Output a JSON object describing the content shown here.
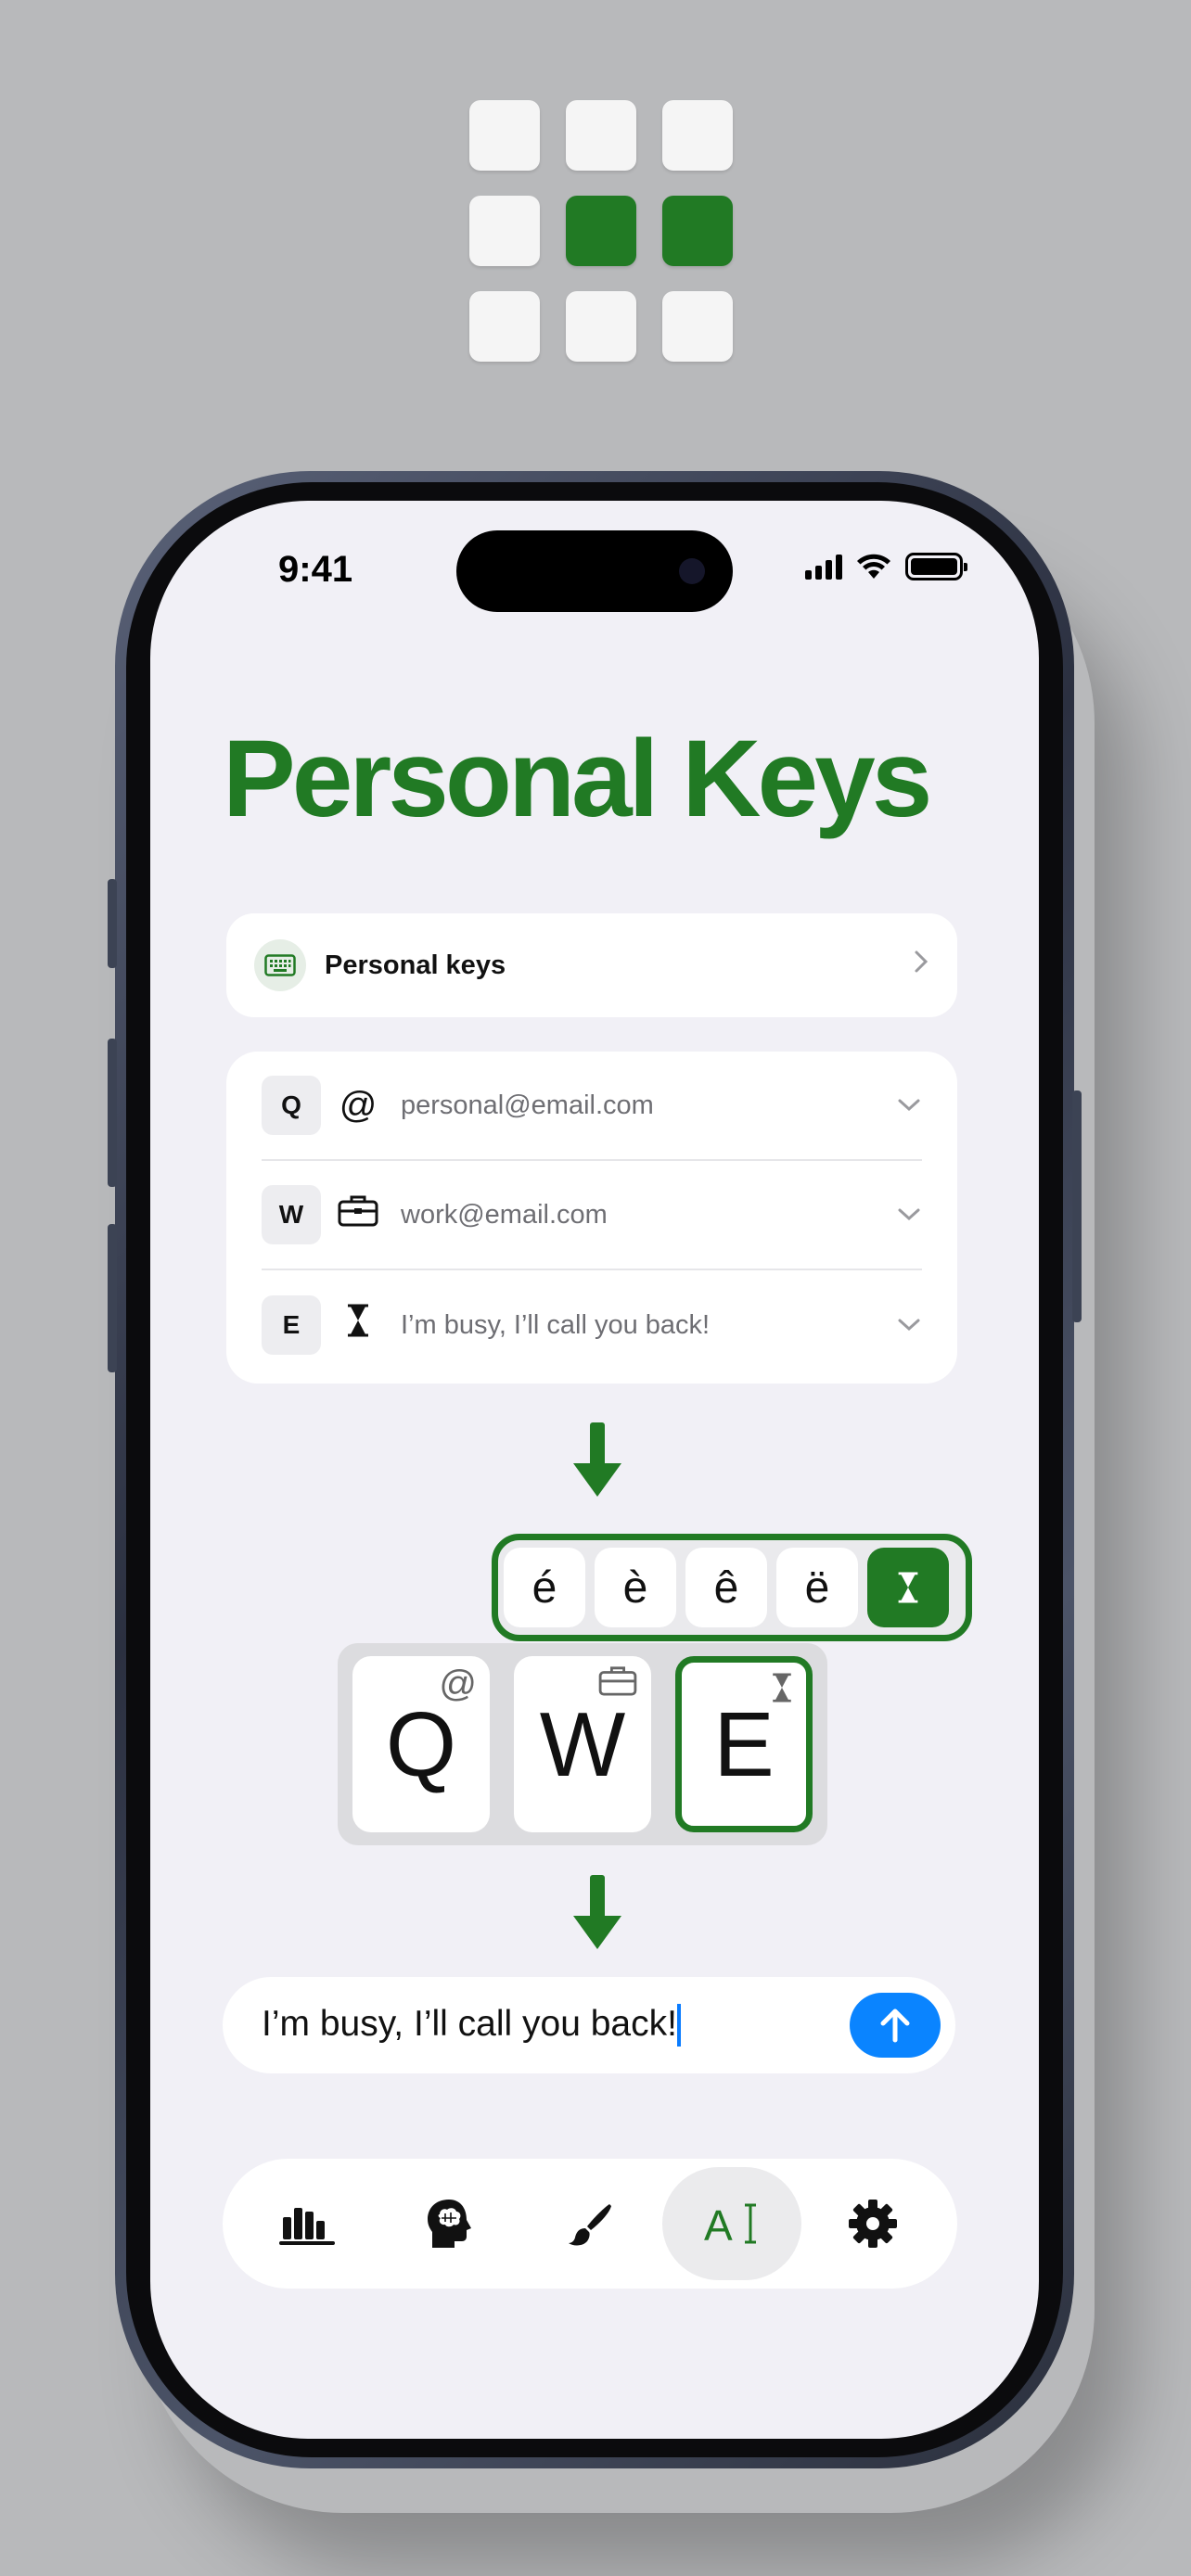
{
  "logo": {
    "cells": [
      {
        "on": false
      },
      {
        "on": false
      },
      {
        "on": false
      },
      {
        "on": false
      },
      {
        "on": true
      },
      {
        "on": true
      },
      {
        "on": false
      },
      {
        "on": false
      },
      {
        "on": false
      }
    ],
    "on_color": "#217a24"
  },
  "status_bar": {
    "time": "9:41"
  },
  "page": {
    "title": "Personal Keys"
  },
  "nav_row": {
    "label": "Personal keys",
    "icon": "keyboard-icon"
  },
  "key_mappings": [
    {
      "key": "Q",
      "icon": "at-sign-icon",
      "value": "personal@email.com"
    },
    {
      "key": "W",
      "icon": "briefcase-icon",
      "value": "work@email.com"
    },
    {
      "key": "E",
      "icon": "hourglass-icon",
      "value": "I’m busy, I’ll call you back!"
    }
  ],
  "accent_popup": {
    "keys": [
      "é",
      "è",
      "ê",
      "ë"
    ],
    "active_icon": "hourglass-icon"
  },
  "keyboard": {
    "keys": [
      {
        "label": "Q",
        "sub": "@"
      },
      {
        "label": "W",
        "sub_icon": "briefcase-icon"
      },
      {
        "label": "E",
        "sub_icon": "hourglass-icon",
        "active": true
      }
    ]
  },
  "message": {
    "text": "I’m busy, I’ll call you back!"
  },
  "tab_bar": {
    "tabs": [
      {
        "icon": "bar-chart-icon"
      },
      {
        "icon": "brain-head-icon"
      },
      {
        "icon": "paintbrush-icon"
      },
      {
        "icon": "text-cursor-icon",
        "label": "A",
        "active": true
      },
      {
        "icon": "gear-icon"
      }
    ]
  },
  "colors": {
    "accent": "#217a24",
    "send": "#0a84ff",
    "screen_bg": "#f1f0f6",
    "page_bg": "#b8b9bb"
  }
}
